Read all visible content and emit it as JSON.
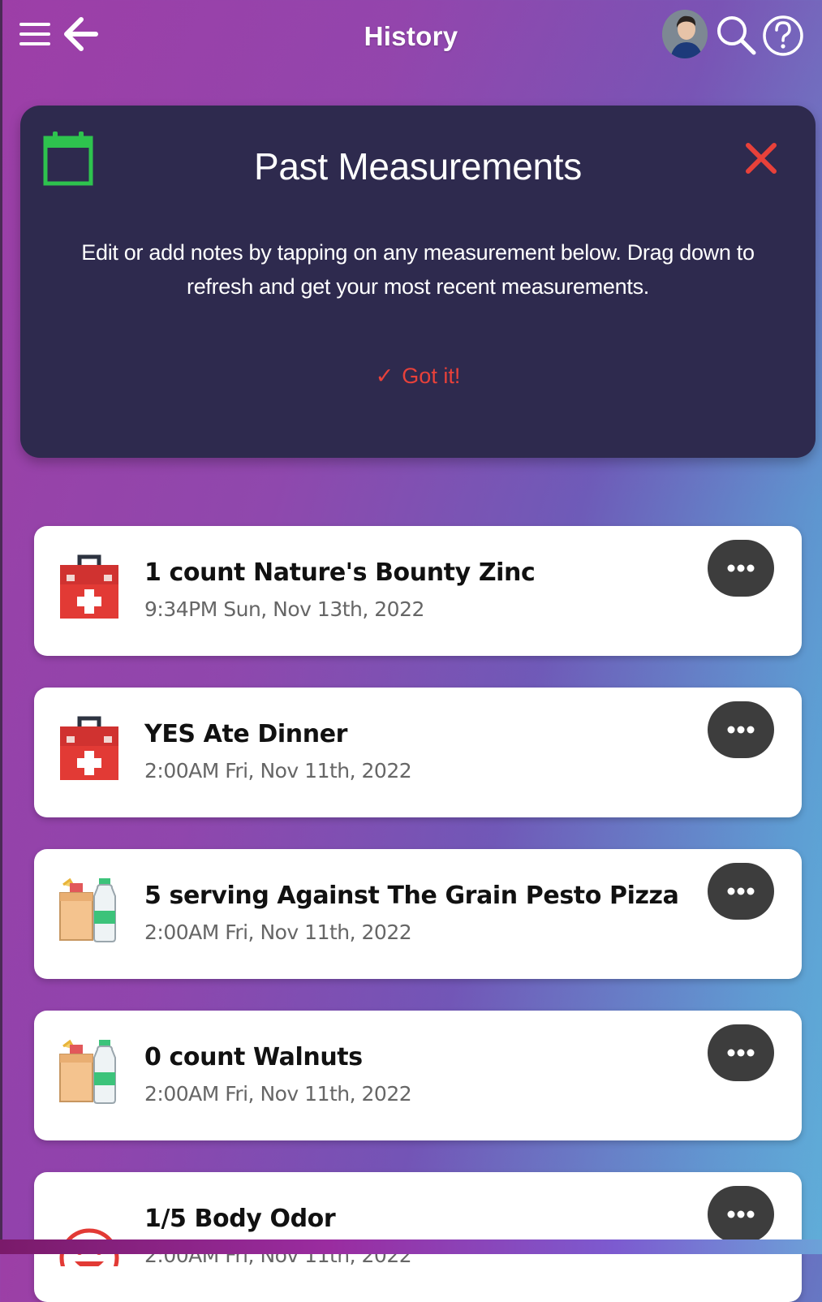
{
  "header": {
    "title": "History",
    "icons": [
      "menu-icon",
      "back-arrow-icon",
      "avatar",
      "search-icon",
      "help-icon"
    ]
  },
  "info_card": {
    "title": "Past Measurements",
    "text": "Edit or add notes by tapping on any measurement below. Drag down to refresh and get your most recent measurements.",
    "action_label": "Got it!",
    "icons": [
      "calendar-icon",
      "close-icon",
      "checkmark-icon"
    ],
    "colors": {
      "calendar": "#2ec34e",
      "close": "#e8413a",
      "card_bg": "#2e2a4e"
    }
  },
  "measurements": [
    {
      "title": "1 count Nature's Bounty Zinc",
      "time": "9:34PM Sun, Nov 13th, 2022",
      "icon": "first-aid-kit-icon"
    },
    {
      "title": "YES Ate Dinner",
      "time": "2:00AM Fri, Nov 11th, 2022",
      "icon": "first-aid-kit-icon"
    },
    {
      "title": "5 serving Against The Grain Pesto Pizza",
      "time": "2:00AM Fri, Nov 11th, 2022",
      "icon": "groceries-icon"
    },
    {
      "title": "0 count Walnuts",
      "time": "2:00AM Fri, Nov 11th, 2022",
      "icon": "groceries-icon"
    },
    {
      "title": "1/5 Body Odor",
      "time": "2:00AM Fri, Nov 11th, 2022",
      "icon": "smiley-face-icon"
    }
  ]
}
